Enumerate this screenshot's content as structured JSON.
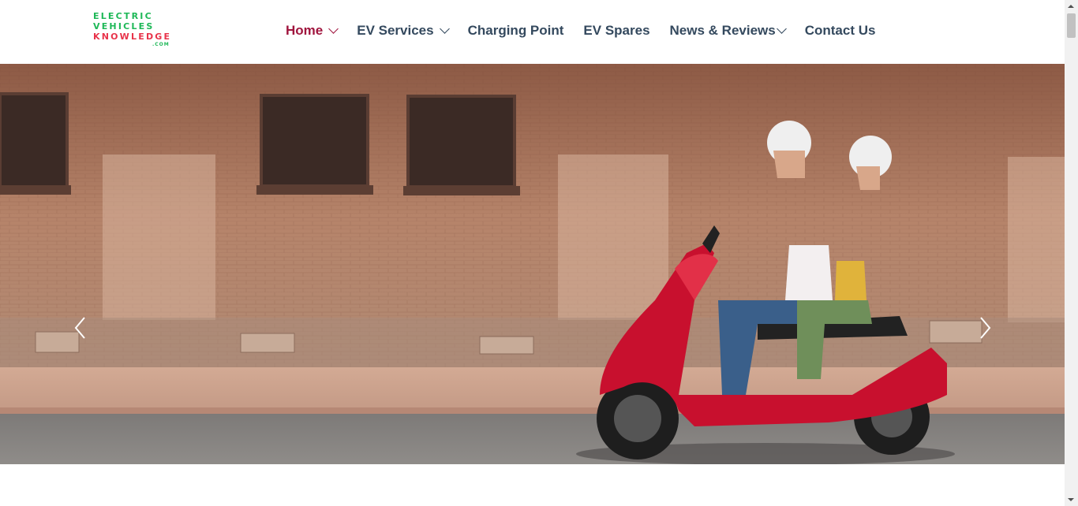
{
  "logo": {
    "line1": "ELECTRIC",
    "line2": "VEHICLES",
    "line3": "KNOWLEDGE",
    "line4": ".COM",
    "colors": {
      "primary": "#1fb858",
      "secondary": "#e8334a"
    }
  },
  "nav": {
    "items": [
      {
        "label": "Home",
        "has_dropdown": true,
        "active": true
      },
      {
        "label": "EV Services",
        "has_dropdown": true,
        "active": false
      },
      {
        "label": "Charging Point",
        "has_dropdown": false,
        "active": false
      },
      {
        "label": "EV Spares",
        "has_dropdown": false,
        "active": false
      },
      {
        "label": "News & Reviews",
        "has_dropdown": true,
        "active": false
      },
      {
        "label": "Contact Us",
        "has_dropdown": false,
        "active": false
      }
    ],
    "colors": {
      "active": "#a0153e",
      "default": "#34495e"
    }
  },
  "hero": {
    "image": "couple-riding-red-scooter",
    "prev_icon": "chevron-left-icon",
    "next_icon": "chevron-right-icon"
  }
}
